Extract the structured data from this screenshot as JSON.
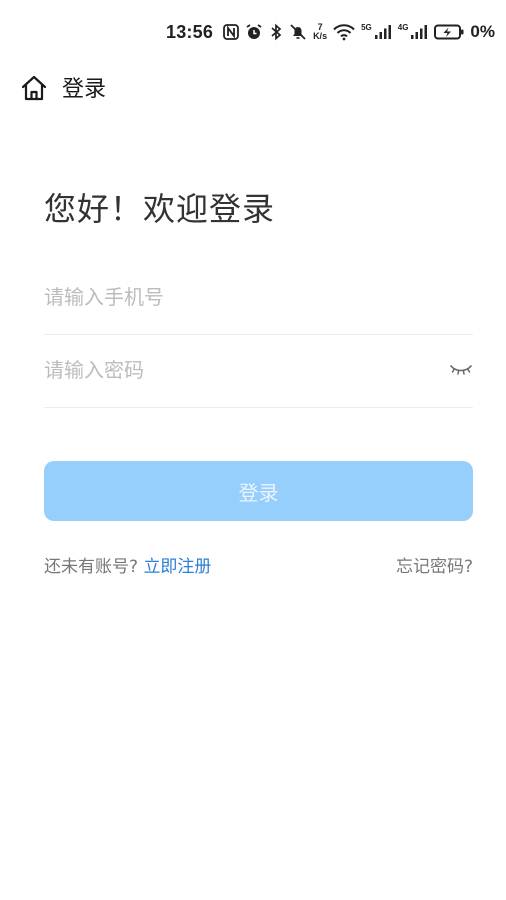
{
  "status_bar": {
    "time": "13:56",
    "net_speed_value": "7",
    "net_speed_unit": "K/s",
    "sim1_label": "5G",
    "sim2_label": "4G",
    "battery_percent": "0%",
    "icons": [
      "nfc-icon",
      "alarm-icon",
      "bluetooth-icon",
      "mute-icon",
      "wifi-icon",
      "signal-icon",
      "battery-charging-icon"
    ]
  },
  "header": {
    "title": "登录",
    "home_icon": "home-icon"
  },
  "main": {
    "greeting": "您好！欢迎登录",
    "phone_placeholder": "请输入手机号",
    "phone_value": "",
    "password_placeholder": "请输入密码",
    "password_value": "",
    "password_toggle_icon": "eye-closed-icon",
    "login_button": "登录",
    "no_account_text": "还未有账号?",
    "register_link": "立即注册",
    "forgot_link": "忘记密码?"
  },
  "colors": {
    "accent": "#2d7fd4",
    "button_disabled": "#96cffb"
  }
}
